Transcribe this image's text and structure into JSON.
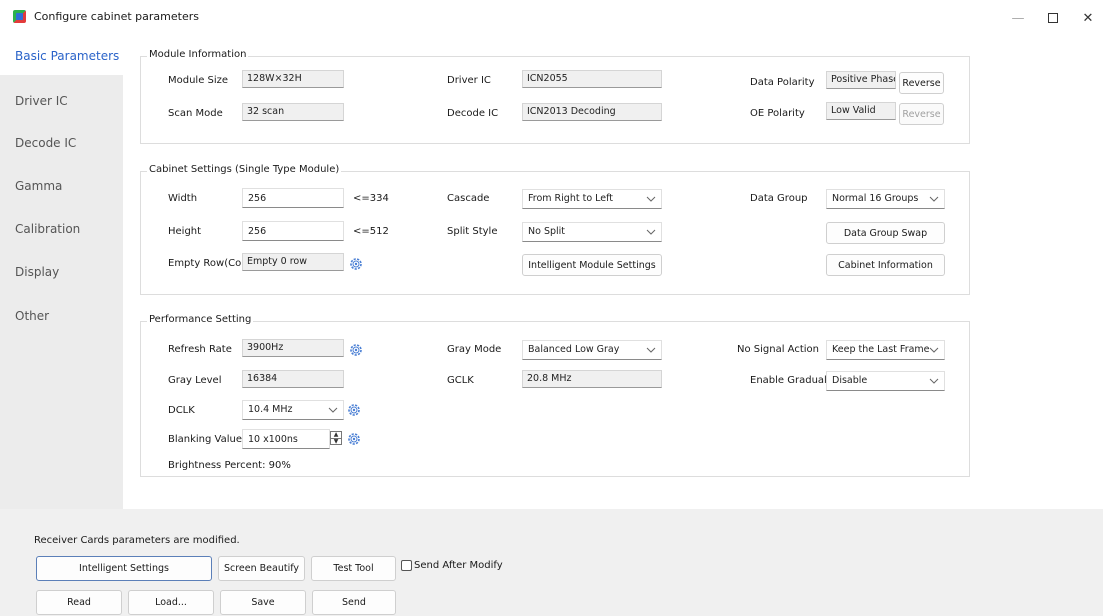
{
  "window": {
    "title": "Configure cabinet parameters"
  },
  "sidebar": {
    "items": [
      {
        "label": "Basic Parameters",
        "active": true
      },
      {
        "label": "Driver IC"
      },
      {
        "label": "Decode IC"
      },
      {
        "label": "Gamma"
      },
      {
        "label": "Calibration"
      },
      {
        "label": "Display"
      },
      {
        "label": "Other"
      }
    ]
  },
  "module_info": {
    "title": "Module Information",
    "module_size": {
      "label": "Module Size",
      "value": "128W×32H"
    },
    "scan_mode": {
      "label": "Scan Mode",
      "value": "32 scan"
    },
    "driver_ic": {
      "label": "Driver IC",
      "value": "ICN2055"
    },
    "decode_ic": {
      "label": "Decode IC",
      "value": "ICN2013 Decoding"
    },
    "data_polarity": {
      "label": "Data Polarity",
      "value": "Positive Phase",
      "button": "Reverse"
    },
    "oe_polarity": {
      "label": "OE Polarity",
      "value": "Low Valid",
      "button": "Reverse"
    }
  },
  "cabinet": {
    "title": "Cabinet Settings (Single Type Module)",
    "width": {
      "label": "Width",
      "value": "256",
      "limit": "<=334"
    },
    "height": {
      "label": "Height",
      "value": "256",
      "limit": "<=512"
    },
    "empty_row": {
      "label": "Empty Row(Col)",
      "value": "Empty 0 row"
    },
    "cascade": {
      "label": "Cascade",
      "value": "From Right to Left"
    },
    "split_style": {
      "label": "Split Style",
      "value": "No Split"
    },
    "intelligent_module_button": "Intelligent Module Settings",
    "data_group": {
      "label": "Data Group",
      "value": "Normal 16 Groups"
    },
    "data_group_swap_button": "Data Group Swap",
    "cabinet_info_button": "Cabinet Information"
  },
  "performance": {
    "title": "Performance Setting",
    "refresh_rate": {
      "label": "Refresh Rate",
      "value": "3900Hz"
    },
    "gray_level": {
      "label": "Gray Level",
      "value": "16384"
    },
    "dclk": {
      "label": "DCLK",
      "value": "10.4 MHz"
    },
    "blanking": {
      "label": "Blanking Value",
      "value": "10 x100ns"
    },
    "brightness": {
      "label": "Brightness Percent:",
      "value": "90%"
    },
    "gray_mode": {
      "label": "Gray Mode",
      "value": "Balanced Low Gray"
    },
    "gclk": {
      "label": "GCLK",
      "value": "20.8 MHz"
    },
    "no_signal": {
      "label": "No Signal Action",
      "value": "Keep the Last Frame"
    },
    "enable_gradual": {
      "label": "Enable Gradual",
      "value": "Disable"
    }
  },
  "footer": {
    "status": "Receiver Cards parameters are modified.",
    "intelligent_settings": "Intelligent Settings",
    "screen_beautify": "Screen Beautify",
    "test_tool": "Test Tool",
    "send_after_modify": "Send After Modify",
    "read": "Read",
    "load": "Load...",
    "save": "Save",
    "send": "Send"
  },
  "colors": {
    "accent": "#2a63c9",
    "sidebar_bg": "#ececec",
    "footer_bg": "#f0f0f0",
    "gear": "#4a7fd4"
  }
}
